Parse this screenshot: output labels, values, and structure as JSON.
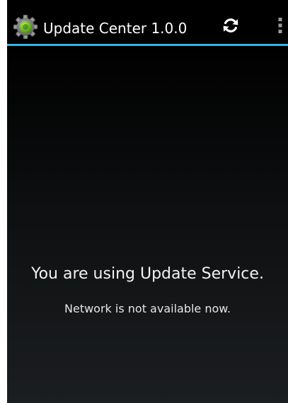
{
  "colors": {
    "action_bar_background": "#000000",
    "action_bar_divider": "#33b5e5",
    "title_text": "#ffffff",
    "content_text": "#f2f2f2"
  },
  "action_bar": {
    "title": "Update Center 1.0.0",
    "app_icon": "gear-icon",
    "refresh_icon": "refresh-icon",
    "overflow_icon": "overflow-menu-icon"
  },
  "content": {
    "headline": "You are using Update Service.",
    "status_message": "Network is not available now."
  }
}
